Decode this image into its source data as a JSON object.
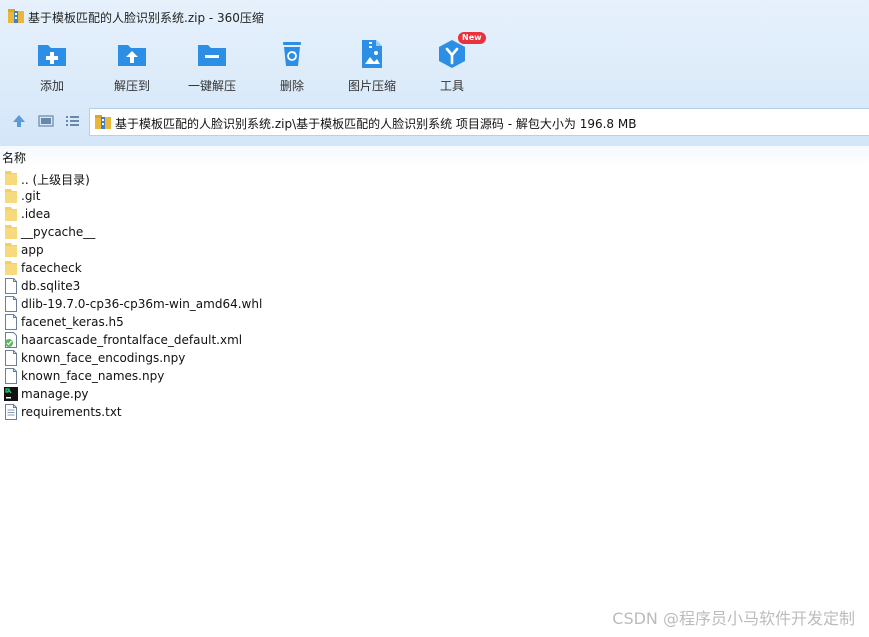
{
  "window": {
    "title": "基于模板匹配的人脸识别系统.zip - 360压缩"
  },
  "toolbar": {
    "add": "添加",
    "extract_to": "解压到",
    "one_click_extract": "一键解压",
    "delete": "删除",
    "image_compress": "图片压缩",
    "tools": "工具",
    "tools_badge": "New"
  },
  "address": {
    "path": "基于模板匹配的人脸识别系统.zip\\基于模板匹配的人脸识别系统 项目源码 - 解包大小为 196.8 MB"
  },
  "columns": {
    "name": "名称"
  },
  "files": [
    {
      "name": ".. (上级目录)",
      "type": "folder"
    },
    {
      "name": ".git",
      "type": "folder"
    },
    {
      "name": ".idea",
      "type": "folder"
    },
    {
      "name": "__pycache__",
      "type": "folder"
    },
    {
      "name": "app",
      "type": "folder"
    },
    {
      "name": "facecheck",
      "type": "folder"
    },
    {
      "name": "db.sqlite3",
      "type": "file"
    },
    {
      "name": "dlib-19.7.0-cp36-cp36m-win_amd64.whl",
      "type": "file"
    },
    {
      "name": "facenet_keras.h5",
      "type": "file"
    },
    {
      "name": "haarcascade_frontalface_default.xml",
      "type": "xml"
    },
    {
      "name": "known_face_encodings.npy",
      "type": "file"
    },
    {
      "name": "known_face_names.npy",
      "type": "file"
    },
    {
      "name": "manage.py",
      "type": "python"
    },
    {
      "name": "requirements.txt",
      "type": "text"
    }
  ],
  "watermark": "CSDN @程序员小马软件开发定制",
  "colors": {
    "accent": "#2d8ee6",
    "folder": "#f3cf6a",
    "badge": "#e8323c"
  }
}
